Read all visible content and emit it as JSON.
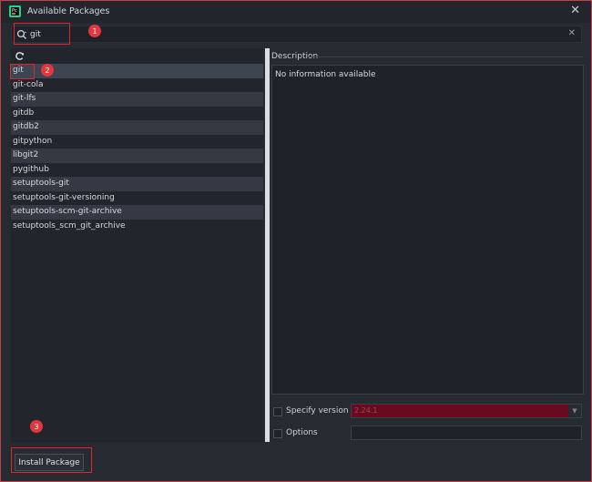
{
  "window": {
    "title": "Available Packages",
    "close_glyph": "✕",
    "app_icon": "pycharm-icon"
  },
  "search": {
    "value": "git",
    "clear_glyph": "✕",
    "icon": "search-icon"
  },
  "annotations": [
    "1",
    "2",
    "3"
  ],
  "packages": [
    "git",
    "git-cola",
    "git-lfs",
    "gitdb",
    "gitdb2",
    "gitpython",
    "libgit2",
    "pygithub",
    "setuptools-git",
    "setuptools-git-versioning",
    "setuptools-scm-git-archive",
    "setuptools_scm_git_archive"
  ],
  "selected_package": "git",
  "description": {
    "label": "Description",
    "text": "No information available"
  },
  "options": {
    "specify_version_label": "Specify version",
    "version_value": "2.24.1",
    "options_label": "Options",
    "options_value": ""
  },
  "install_button": "Install Package",
  "colors": {
    "accent": "#e3242b",
    "version_bg": "#6a0a1f",
    "background": "#262a31"
  }
}
